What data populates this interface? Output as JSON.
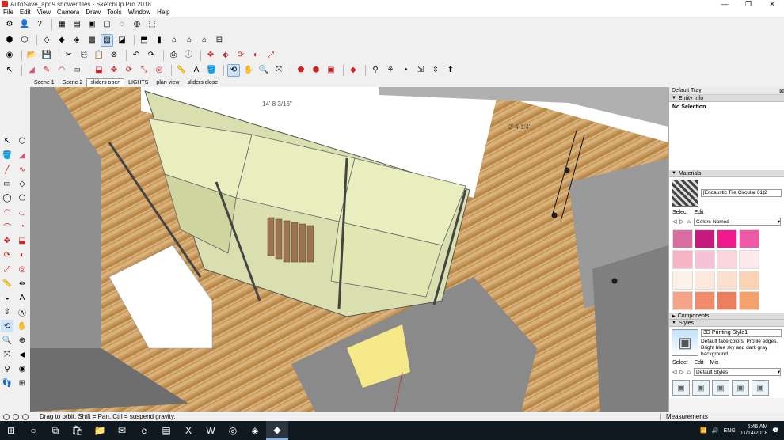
{
  "window": {
    "title": "AutoSave_apd9 shower tiles - SketchUp Pro 2018",
    "controls": [
      "—",
      "❐",
      "✕"
    ]
  },
  "menu": [
    "File",
    "Edit",
    "View",
    "Camera",
    "Draw",
    "Tools",
    "Window",
    "Help"
  ],
  "scenes": {
    "tabs": [
      "Scene 1",
      "Scene 2",
      "sliders open",
      "LIGHTS",
      "plan view",
      "sliders close"
    ],
    "active_index": 2
  },
  "viewport": {
    "dimension_labels": [
      "14' 8 3/16\"",
      "2' 4 1/4\""
    ]
  },
  "tray": {
    "title": "Default Tray",
    "entity_info": {
      "header": "Entity Info",
      "status": "No Selection"
    },
    "materials": {
      "header": "Materials",
      "current_name": "[Encaustic Tile Circular 01]2",
      "tab_select": "Select",
      "tab_edit": "Edit",
      "library": "Colors-Named",
      "swatches": [
        "#d96fa0",
        "#c8197e",
        "#f01a8c",
        "#ef5aa8",
        "#f7b3c6",
        "#f4c2d4",
        "#fbd6de",
        "#fbe9ee",
        "#fdf2ea",
        "#fde9dc",
        "#fbe0d0",
        "#fcd2b4",
        "#f5a487",
        "#f08c6c",
        "#ee7f5e",
        "#f4a16b"
      ]
    },
    "components": {
      "header": "Components"
    },
    "styles": {
      "header": "Styles",
      "current_name": "3D Printing Style1",
      "description": "Default face colors. Profile edges. Bright blue sky and dark gray background.",
      "tab_select": "Select",
      "tab_edit": "Edit",
      "tab_mix": "Mix",
      "library": "Default Styles"
    }
  },
  "status": {
    "message": "Drag to orbit. Shift = Pan, Ctrl = suspend gravity.",
    "measurements_label": "Measurements"
  },
  "taskbar": {
    "language": "ENG",
    "time": "6:46 AM",
    "date": "11/14/2018"
  },
  "colors": {
    "wood": "#c99a5e",
    "shelf": "#e8eebd",
    "wall_gray": "#8f8f8f",
    "selection_blue": "#cde3f7"
  }
}
